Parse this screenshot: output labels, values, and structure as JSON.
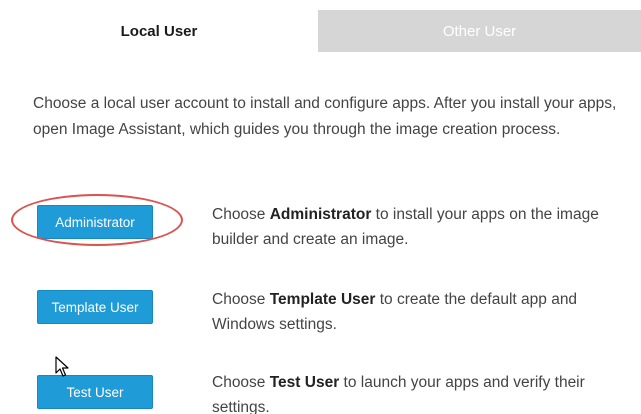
{
  "tabs": {
    "local_user": "Local User",
    "other_user": "Other User"
  },
  "intro": "Choose a local user account to install and configure apps. After you install your apps, open Image Assistant, which guides you through the image creation process.",
  "rows": [
    {
      "button_label": "Administrator",
      "desc_prefix": "Choose ",
      "desc_bold": "Administrator",
      "desc_suffix": " to install your apps on the image builder and create an image."
    },
    {
      "button_label": "Template User",
      "desc_prefix": "Choose ",
      "desc_bold": "Template User",
      "desc_suffix": " to create the default app and Windows settings."
    },
    {
      "button_label": "Test User",
      "desc_prefix": "Choose ",
      "desc_bold": "Test User",
      "desc_suffix": " to launch your apps and verify their settings."
    }
  ],
  "colors": {
    "button_bg": "#1f9bd7",
    "inactive_tab_bg": "#d6d6d6",
    "highlight": "#d9534f"
  }
}
